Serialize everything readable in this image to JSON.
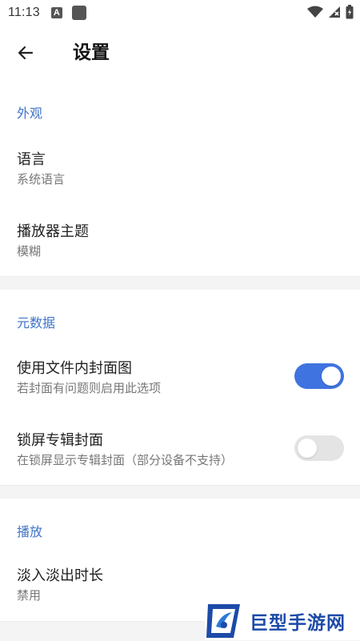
{
  "status_bar": {
    "time": "11:13",
    "notification_letter": "A",
    "icons": [
      "a-notification-icon",
      "app-notification-icon",
      "wifi-icon",
      "signal-icon",
      "battery-icon"
    ]
  },
  "app_bar": {
    "title": "设置",
    "back_icon": "arrow-back-icon"
  },
  "sections": {
    "appearance": {
      "header": "外观",
      "language": {
        "title": "语言",
        "subtitle": "系统语言"
      },
      "player_theme": {
        "title": "播放器主题",
        "subtitle": "模糊"
      }
    },
    "metadata": {
      "header": "元数据",
      "embedded_cover": {
        "title": "使用文件内封面图",
        "subtitle": "若封面有问题则启用此选项",
        "enabled": true
      },
      "lockscreen_cover": {
        "title": "锁屏专辑封面",
        "subtitle": "在锁屏显示专辑封面（部分设备不支持）",
        "enabled": false
      }
    },
    "playback": {
      "header": "播放",
      "fade": {
        "title": "淡入淡出时长",
        "subtitle": "禁用"
      }
    }
  },
  "watermark": {
    "text": "巨型手游网"
  },
  "colors": {
    "accent": "#3f73c8",
    "toggle_on": "#3f73e0",
    "toggle_off": "#e4e4e4",
    "divider": "#f4f4f4"
  }
}
